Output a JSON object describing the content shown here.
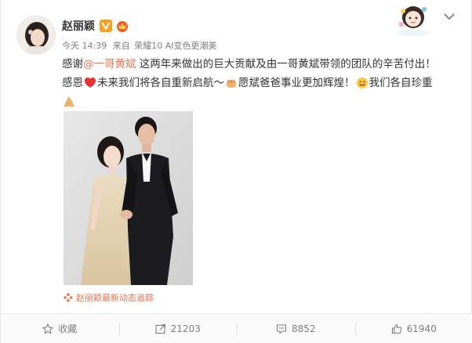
{
  "post": {
    "author": "赵丽颖",
    "meta": {
      "time": "今天 14:39",
      "from_prefix": "来自",
      "source": "荣耀10 AI变色更潮美"
    },
    "content": {
      "line1_a": "感谢",
      "mention": "@一哥黄斌",
      "line1_b": " 这两年来做出的巨大贡献及由一哥黄斌带领的团队的辛苦付出！",
      "line2_a": "感恩",
      "line2_b": "未来我们将各自重新启航～",
      "line2_c": "愿斌爸爸事业更加辉煌！",
      "line2_d": "我们各自珍重"
    },
    "super_topic": "赵丽颖最新动态追踪",
    "icons": {
      "verified": "vip-v-icon",
      "crown": "crown-icon",
      "heart": "heart-emoji",
      "fist": "fist-emoji",
      "smile": "smile-emoji",
      "pray": "pray-emoji"
    },
    "colors": {
      "accent": "#eb7350",
      "meta": "#808080"
    }
  },
  "actions": {
    "favorite": "收藏",
    "repost_count": "21203",
    "comment_count": "8852",
    "like_count": "61940"
  }
}
